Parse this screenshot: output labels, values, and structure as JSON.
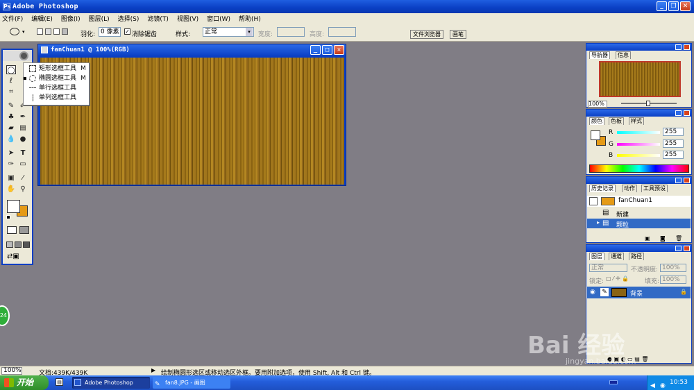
{
  "app": {
    "title": "Adobe Photoshop"
  },
  "menu": [
    "文件(F)",
    "编辑(E)",
    "图像(I)",
    "图层(L)",
    "选择(S)",
    "滤镜(T)",
    "视图(V)",
    "窗口(W)",
    "帮助(H)"
  ],
  "options": {
    "feather_label": "羽化:",
    "feather_value": "0 像素",
    "antialias_label": "消除锯齿",
    "style_label": "样式:",
    "style_value": "正常",
    "width_label": "宽度:",
    "height_label": "高度:",
    "file_browser_tab": "文件浏览器",
    "brushes_tab": "画笔"
  },
  "flyout": [
    {
      "label": "矩形选框工具",
      "key": "M"
    },
    {
      "label": "椭圆选框工具",
      "key": "M"
    },
    {
      "label": "单行选框工具",
      "key": ""
    },
    {
      "label": "单列选框工具",
      "key": ""
    }
  ],
  "document": {
    "title": "fanChuan1 @ 100%(RGB)"
  },
  "navigator": {
    "tabs": [
      "导航器",
      "信息"
    ],
    "zoom": "100%"
  },
  "color_panel": {
    "tabs": [
      "颜色",
      "色板",
      "样式"
    ],
    "channels": [
      {
        "name": "R",
        "value": "255"
      },
      {
        "name": "G",
        "value": "255"
      },
      {
        "name": "B",
        "value": "255"
      }
    ]
  },
  "history": {
    "tabs": [
      "历史记录",
      "动作",
      "工具预设"
    ],
    "snapshot": "fanChuan1",
    "items": [
      "新建",
      "颗粒"
    ]
  },
  "layers": {
    "tabs": [
      "图层",
      "通道",
      "路径"
    ],
    "mode": "正常",
    "opacity_label": "不透明度:",
    "opacity": "100%",
    "lock_label": "锁定:",
    "fill_label": "填充:",
    "fill": "100%",
    "layer_name": "背景"
  },
  "status": {
    "zoom": "100%",
    "doc_size": "文档:439K/439K",
    "hint": "绘制椭圆形选区或移动选区外框。要用附加选项，使用 Shift, Alt 和 Ctrl 键。"
  },
  "taskbar": {
    "start": "开始",
    "tasks": [
      "Adobe Photoshop",
      "fan8.JPG - 画图"
    ],
    "clock": "10:53",
    "badge": "24"
  },
  "watermark": {
    "text": "Bai 经验",
    "url": "jingyan.baidu.com"
  },
  "colors": {
    "titlebar": "#0a3fc4",
    "chrome": "#ece9d8",
    "workspace": "#807d85",
    "wood": "#a57a1b",
    "history_selected": "#316ac5"
  }
}
